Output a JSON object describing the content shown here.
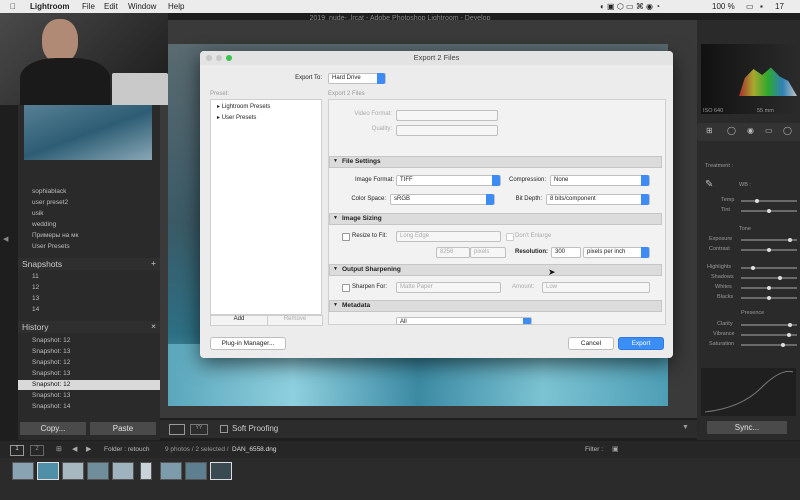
{
  "menubar": {
    "app": "Lightroom",
    "items": [
      "File",
      "Edit",
      "Window",
      "Help"
    ],
    "battery": "100 %",
    "clock": "17"
  },
  "window": {
    "title": "2019_nude- .lrcat - Adobe Photoshop Lightroom - Develop"
  },
  "left_panel": {
    "presets": [
      "sophiablack",
      "user preset2",
      "usik",
      "wedding",
      "Примеры на мк",
      "User Presets"
    ],
    "snapshots_title": "Snapshots",
    "snapshots": [
      "11",
      "12",
      "13",
      "14"
    ],
    "history_title": "History",
    "history": [
      "Snapshot: 12",
      "Snapshot: 13",
      "Snapshot: 12",
      "Snapshot: 13",
      "Snapshot: 12",
      "Snapshot: 13",
      "Snapshot: 14"
    ],
    "history_selected": 4,
    "copy_label": "Copy...",
    "paste_label": "Paste"
  },
  "toolbar": {
    "soft_proofing": "Soft Proofing"
  },
  "right_panel": {
    "iso": "ISO 640",
    "focal": "55 mm",
    "treatment": "Treatment :",
    "wb": "WB :",
    "temp": "Temp",
    "tint": "Tint",
    "tone": "Tone",
    "exposure": "Exposure",
    "contrast": "Contrast",
    "highlights": "Highlights",
    "shadows": "Shadows",
    "whites": "Whites",
    "blacks": "Blacks",
    "presence": "Presence",
    "clarity": "Clarity",
    "vibrance": "Vibrance",
    "saturation": "Saturation",
    "sync": "Sync...",
    "sliders": {
      "temp": 0.28,
      "tint": 0.5,
      "exposure": 0.88,
      "contrast": 0.5,
      "highlights": 0.22,
      "shadows": 0.7,
      "whites": 0.5,
      "blacks": 0.5,
      "clarity": 0.88,
      "vibrance": 0.85,
      "saturation": 0.75
    }
  },
  "dialog": {
    "title": "Export 2 Files",
    "export_to_label": "Export To:",
    "export_to_value": "Hard Drive",
    "preset_label": "Preset:",
    "preset_items": [
      "Lightroom Presets",
      "User Presets"
    ],
    "export_files_label": "Export 2 Files",
    "add": "Add",
    "remove": "Remove",
    "video_format": "Video Format:",
    "quality": "Quality:",
    "file_settings": "File Settings",
    "image_format_label": "Image Format:",
    "image_format": "TIFF",
    "compression_label": "Compression:",
    "compression": "None",
    "color_space_label": "Color Space:",
    "color_space": "sRGB",
    "bit_depth_label": "Bit Depth:",
    "bit_depth": "8 bits/component",
    "image_sizing": "Image Sizing",
    "resize_label": "Resize to Fit:",
    "resize_value": "Long Edge",
    "dont_enlarge": "Don't Enlarge",
    "size_value": "8256",
    "size_unit": "pixels",
    "resolution_label": "Resolution:",
    "resolution_value": "300",
    "resolution_unit": "pixels per inch",
    "output_sharpening": "Output Sharpening",
    "sharpen_label": "Sharpen For:",
    "sharpen_value": "Matte Paper",
    "amount_label": "Amount:",
    "amount_value": "Low",
    "metadata": "Metadata",
    "metadata_value": "All",
    "plugin_manager": "Plug-in Manager...",
    "cancel": "Cancel",
    "export": "Export"
  },
  "filmbar": {
    "pages": [
      "1",
      "2"
    ],
    "folder": "Folder : retouch",
    "count": "9 photos / 2 selected /",
    "file": "DAN_6558.dng",
    "filter": "Filter :"
  }
}
